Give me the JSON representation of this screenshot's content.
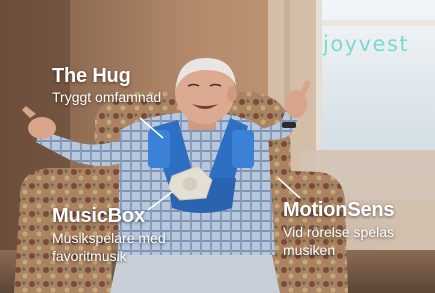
{
  "logo": {
    "text": "joyvest",
    "color": "#7fd9cf"
  },
  "callouts": {
    "hug": {
      "title": "The Hug",
      "subtitle": "Tryggt omfamnad"
    },
    "musicbox": {
      "title": "MusicBox",
      "subtitle_line1": "Musikspelare med",
      "subtitle_line2": "favoritmusik"
    },
    "motionsens": {
      "title": "MotionSens",
      "subtitle_line1": "Vid rörelse spelas",
      "subtitle_line2": "musiken"
    }
  },
  "colors": {
    "vest": "#2d6fc2",
    "speaker": "#e4dfd3",
    "wall": "#b88a66",
    "window": "#dfe9ef"
  }
}
